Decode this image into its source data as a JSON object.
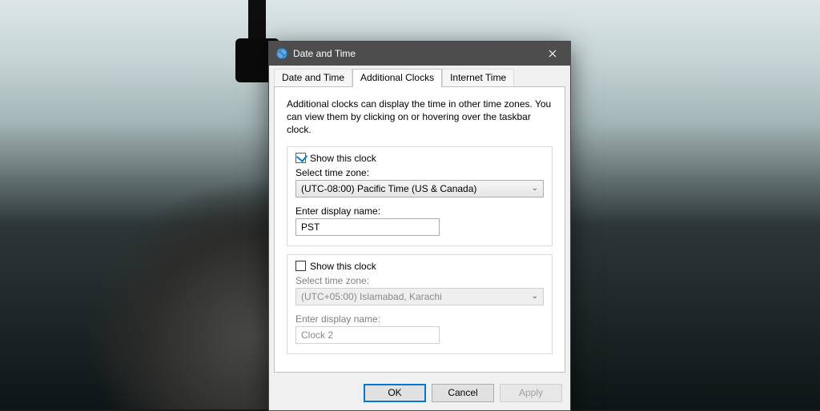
{
  "window": {
    "title": "Date and Time"
  },
  "tabs": {
    "date_time": "Date and Time",
    "additional_clocks": "Additional Clocks",
    "internet_time": "Internet Time"
  },
  "intro_text": "Additional clocks can display the time in other time zones. You can view them by clicking on or hovering over the taskbar clock.",
  "clock1": {
    "show_label": "Show this clock",
    "tz_label": "Select time zone:",
    "tz_value": "(UTC-08:00) Pacific Time (US & Canada)",
    "name_label": "Enter display name:",
    "name_value": "PST"
  },
  "clock2": {
    "show_label": "Show this clock",
    "tz_label": "Select time zone:",
    "tz_value": "(UTC+05:00) Islamabad, Karachi",
    "name_label": "Enter display name:",
    "name_value": "Clock 2"
  },
  "buttons": {
    "ok": "OK",
    "cancel": "Cancel",
    "apply": "Apply"
  }
}
